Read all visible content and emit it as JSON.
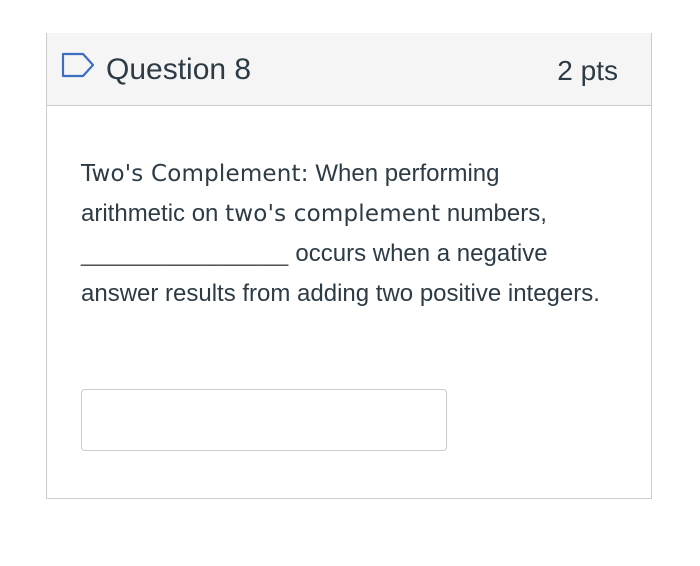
{
  "question": {
    "title": "Question 8",
    "points": "2 pts",
    "flag_icon": "flag-outline-icon",
    "text": {
      "term_label": "Two's Complement:",
      "intro": " When performing arithmetic on ",
      "term_inline": "two's complement",
      "after_term": " numbers,",
      "blank": "_______________",
      "rest": " occurs when a negative answer results from adding two positive integers."
    },
    "answer": {
      "value": "",
      "placeholder": ""
    }
  },
  "colors": {
    "header_background": "#f5f5f5",
    "border": "#c7cdd1",
    "text": "#2d3b45",
    "flag_icon": "#3c6dc1"
  }
}
